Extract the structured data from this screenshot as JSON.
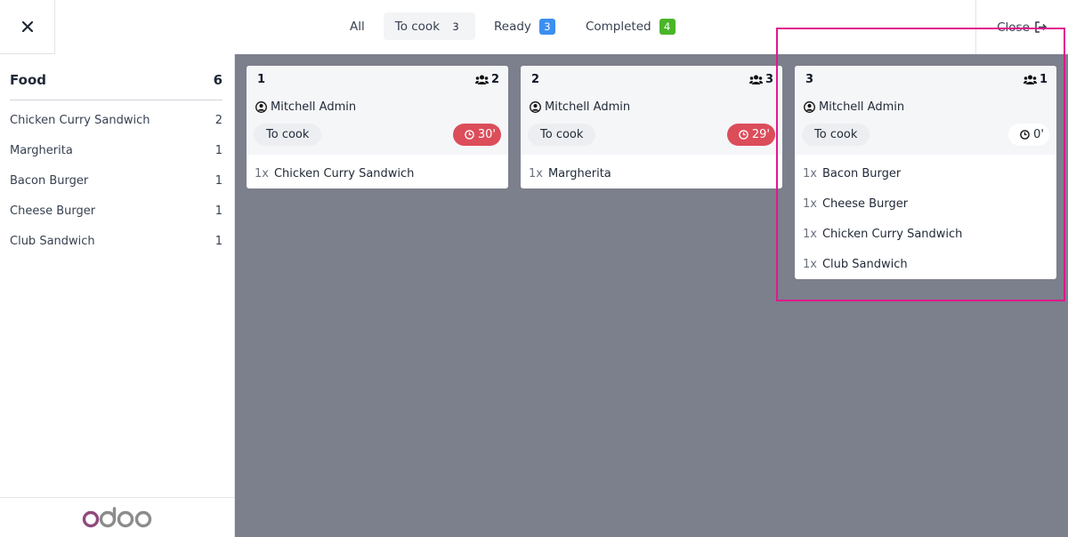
{
  "colors": {
    "accent_highlight": "#e0198c",
    "late_timer": "#dc4d5a",
    "ready_badge": "#3b8ff0",
    "completed_badge": "#4ab528",
    "main_background": "#7c7f8c"
  },
  "topbar": {
    "close_icon": "x-icon",
    "tabs": [
      {
        "label": "All",
        "count": null,
        "active": false
      },
      {
        "label": "To cook",
        "count": "3",
        "active": true
      },
      {
        "label": "Ready",
        "count": "3",
        "active": false
      },
      {
        "label": "Completed",
        "count": "4",
        "active": false
      }
    ],
    "close_label": "Close",
    "close_button_icon": "sign-out-icon"
  },
  "sidebar": {
    "category": "Food",
    "category_count": "6",
    "items": [
      {
        "label": "Chicken Curry Sandwich",
        "count": "2"
      },
      {
        "label": "Margherita",
        "count": "1"
      },
      {
        "label": "Bacon Burger",
        "count": "1"
      },
      {
        "label": "Cheese Burger",
        "count": "1"
      },
      {
        "label": "Club Sandwich",
        "count": "1"
      }
    ],
    "logo": "odoo"
  },
  "orders": [
    {
      "number": "1",
      "guests": "2",
      "user": "Mitchell Admin",
      "state": "To cook",
      "timer": "30'",
      "timer_late": true,
      "lines": [
        {
          "qty": "1x",
          "product": "Chicken Curry Sandwich"
        }
      ]
    },
    {
      "number": "2",
      "guests": "3",
      "user": "Mitchell Admin",
      "state": "To cook",
      "timer": "29'",
      "timer_late": true,
      "lines": [
        {
          "qty": "1x",
          "product": "Margherita"
        }
      ]
    },
    {
      "number": "3",
      "guests": "1",
      "user": "Mitchell Admin",
      "state": "To cook",
      "timer": "0'",
      "timer_late": false,
      "lines": [
        {
          "qty": "1x",
          "product": "Bacon Burger"
        },
        {
          "qty": "1x",
          "product": "Cheese Burger"
        },
        {
          "qty": "1x",
          "product": "Chicken Curry Sandwich"
        },
        {
          "qty": "1x",
          "product": "Club Sandwich"
        }
      ]
    }
  ]
}
